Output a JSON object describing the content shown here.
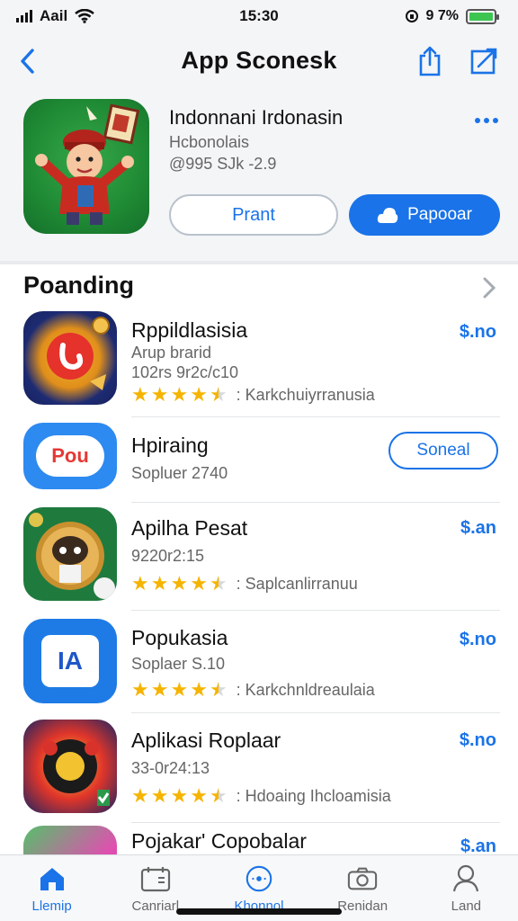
{
  "status": {
    "carrier": "Aail",
    "time": "15:30",
    "battery_text": "9 7%"
  },
  "nav": {
    "title": "App Sconesk"
  },
  "featured": {
    "name": "Indonnani Irdonasin",
    "subtitle": "Hcbonolais",
    "meta": "@995 SJk -2.9",
    "secondary_button": "Prant",
    "primary_button": "Papooar"
  },
  "section": {
    "title": "Poanding"
  },
  "apps": [
    {
      "name": "Rppildlasisia",
      "lines": [
        "Arup brarid",
        "102rs 9r2c/c10"
      ],
      "rating": 4.5,
      "review": ": Karkchuiyrranusia",
      "price": "$.no"
    },
    {
      "name": "Hpiraing",
      "lines": [
        "Sopluer 2740"
      ],
      "button": "Soneal"
    },
    {
      "name": "Apilha Pesat",
      "lines": [
        "9220r2:15"
      ],
      "rating": 4.5,
      "review": ": Saplcanlirranuu",
      "price": "$.an"
    },
    {
      "name": "Popukasia",
      "lines": [
        "Soplaer S.10"
      ],
      "rating": 4.5,
      "review": ": Karkchnldreaulaia",
      "price": "$.no"
    },
    {
      "name": "Aplikasi Roplaar",
      "lines": [
        "33-0r24:13"
      ],
      "rating": 4.5,
      "review": ": Hdoaing Ihcloamisia",
      "price": "$.no"
    },
    {
      "name": "Pojakar' Copobalar",
      "lines": [],
      "price": "$.an"
    }
  ],
  "tabs": [
    {
      "label": "Llemip",
      "icon": "home-icon",
      "active": true
    },
    {
      "label": "Canriarl",
      "icon": "calendar-icon"
    },
    {
      "label": "Khonnol",
      "icon": "channel-icon"
    },
    {
      "label": "Renidan",
      "icon": "camera-icon"
    },
    {
      "label": "Land",
      "icon": "person-icon"
    }
  ],
  "colors": {
    "accent": "#1a73e8",
    "star": "#f5b400",
    "battery": "#3dc552"
  }
}
